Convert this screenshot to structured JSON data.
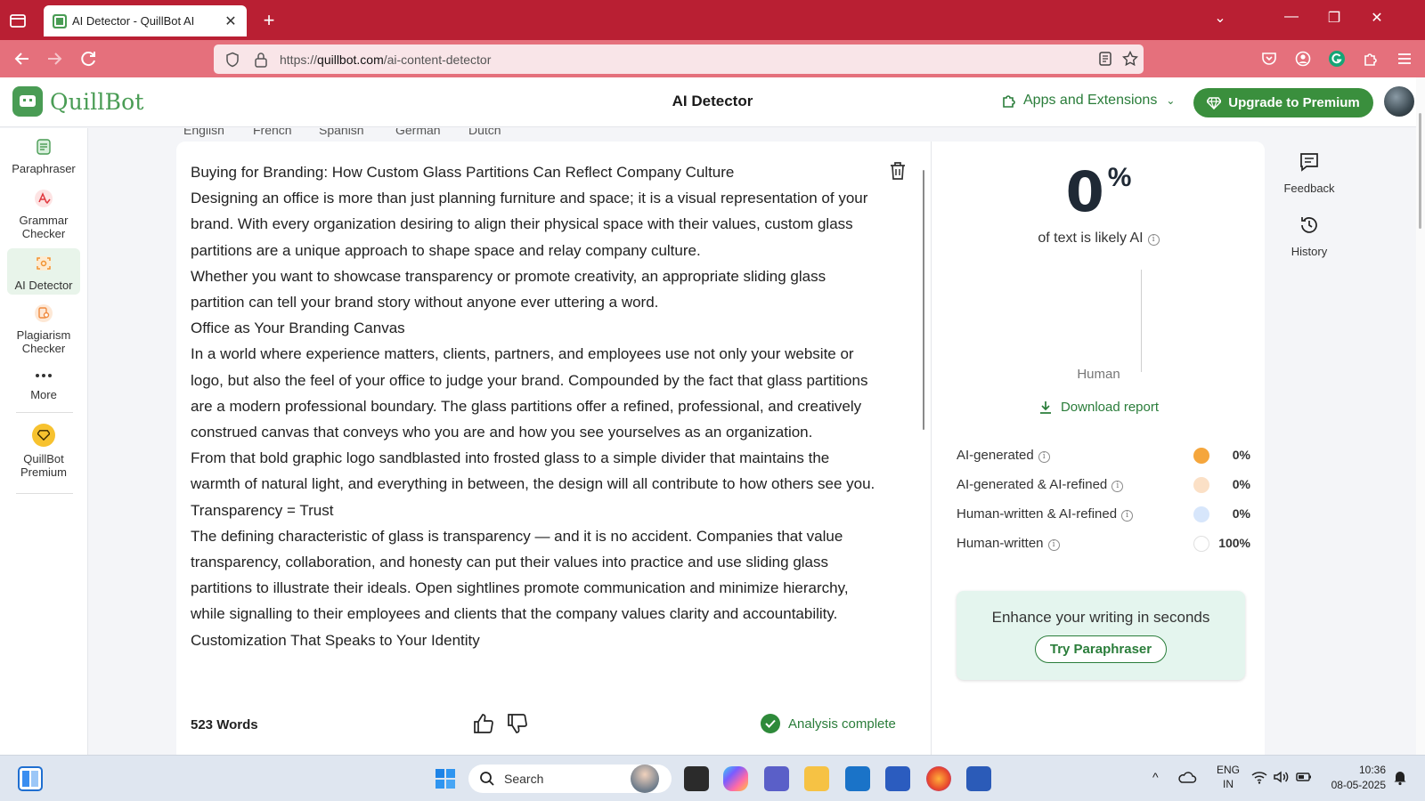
{
  "browser": {
    "tab_title": "AI Detector - QuillBot AI",
    "tab_close": "✕",
    "new_tab": "+",
    "url_prefix": "https://",
    "url_domain": "quillbot.com",
    "url_path": "/ai-content-detector",
    "window_controls": [
      "⌄",
      "—",
      "❐",
      "✕"
    ]
  },
  "header": {
    "logo_text": "QuillBot",
    "page_title": "AI Detector",
    "apps_label": "Apps and Extensions",
    "upgrade_label": "Upgrade to Premium"
  },
  "sidebar": {
    "items": [
      {
        "label": "Paraphraser",
        "icon": "paraphraser-icon"
      },
      {
        "label": "Grammar Checker",
        "icon": "grammar-icon"
      },
      {
        "label": "AI Detector",
        "icon": "ai-detector-icon",
        "active": true
      },
      {
        "label": "Plagiarism Checker",
        "icon": "plagiarism-icon"
      },
      {
        "label": "More",
        "icon": "more-icon"
      },
      {
        "label": "QuillBot Premium",
        "icon": "premium-icon"
      }
    ]
  },
  "language_tabs": [
    "English",
    "French",
    "Spanish",
    "German",
    "Dutch"
  ],
  "editor": {
    "paragraphs": [
      "Buying for Branding: How Custom Glass Partitions Can Reflect Company Culture",
      "Designing an office is more than just planning furniture and space; it is a visual representation of your brand. With every organization desiring to align their physical space with their values, custom glass partitions are a unique approach to shape space and relay company culture.",
      "Whether you want to showcase transparency or promote creativity, an appropriate sliding glass partition can tell your brand story without anyone ever uttering a word.",
      "Office as Your Branding Canvas",
      "In a world where experience matters, clients, partners, and employees use not only your website or logo, but also the feel of your office to judge your brand. Compounded by the fact that glass partitions are a modern professional boundary. The glass partitions offer a refined, professional, and creatively construed canvas that conveys who you are and how you see yourselves as an organization.",
      "From that bold graphic logo sandblasted into frosted glass to a simple divider that maintains the warmth of natural light, and everything in between, the design will all contribute to how others see you.",
      "Transparency = Trust",
      "The defining characteristic of glass is transparency — and it is no accident. Companies that value transparency, collaboration, and honesty can put their values into practice and use sliding glass partitions to illustrate their ideals. Open sightlines promote communication and minimize hierarchy, while signalling to their employees and clients that the company values clarity and accountability.",
      "Customization That Speaks to Your Identity"
    ],
    "word_count": "523 Words",
    "status": "Analysis complete"
  },
  "results": {
    "percent": "0",
    "percent_sign": "%",
    "likely_text": "of text is likely AI",
    "chart_label": "Human",
    "download_label": "Download report",
    "legend": [
      {
        "label": "AI-generated",
        "value": "0%",
        "color": "#f5a63c"
      },
      {
        "label": "AI-generated & AI-refined",
        "value": "0%",
        "color": "#fbe0c6"
      },
      {
        "label": "Human-written & AI-refined",
        "value": "0%",
        "color": "#d7e6fb"
      },
      {
        "label": "Human-written",
        "value": "100%",
        "color": "#ffffff"
      }
    ],
    "enhance_title": "Enhance your writing in seconds",
    "enhance_button": "Try Paraphraser"
  },
  "rail": {
    "feedback": "Feedback",
    "history": "History"
  },
  "taskbar": {
    "search": "Search",
    "lang_1": "ENG",
    "lang_2": "IN",
    "time": "10:36",
    "date": "08-05-2025"
  },
  "colors": {
    "brand_green": "#499c54",
    "accent_green": "#2a7d3a",
    "browser_red": "#b91f33"
  }
}
